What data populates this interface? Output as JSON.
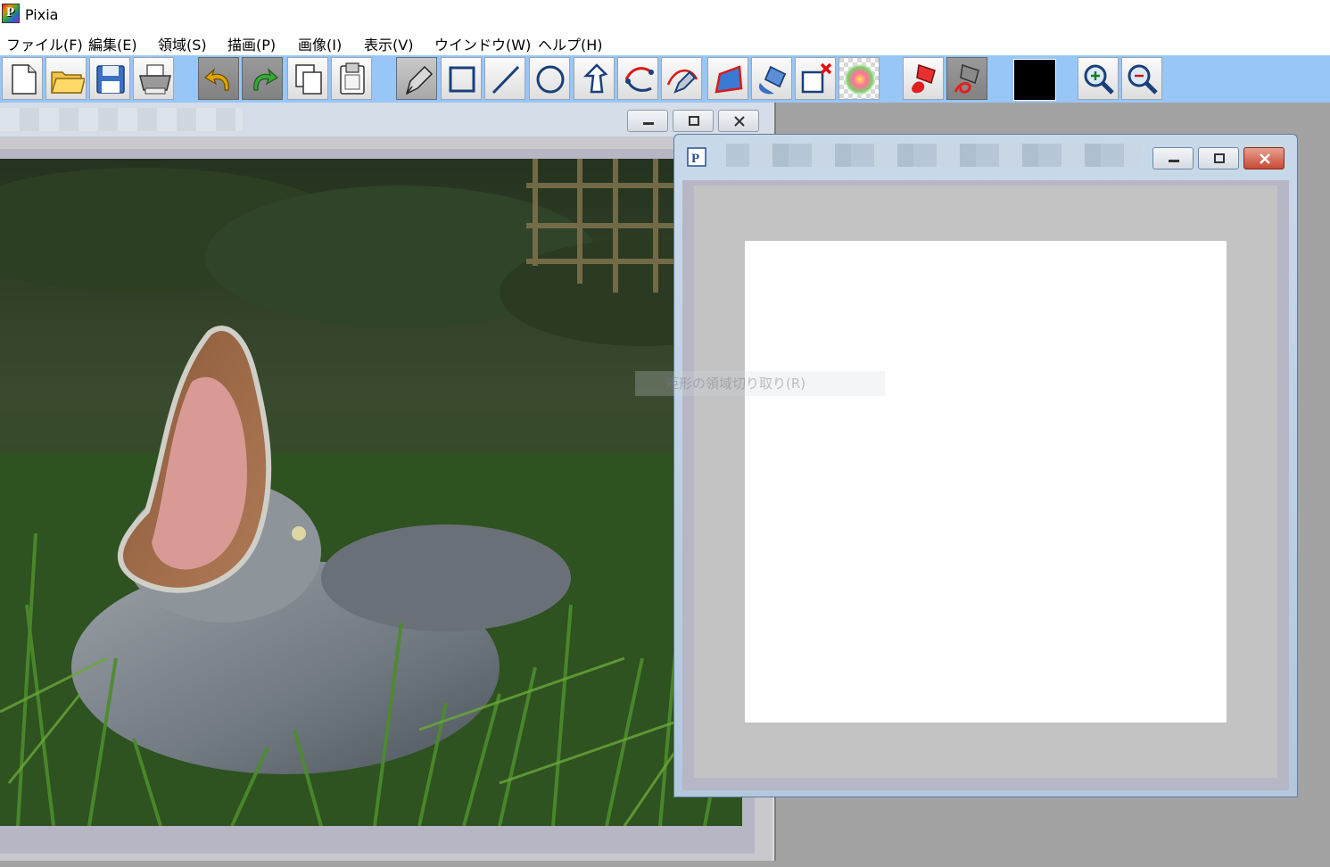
{
  "app": {
    "title": "Pixia",
    "icon": "pixia-app-icon"
  },
  "menu": [
    {
      "label": "ファイル(F)"
    },
    {
      "label": "編集(E)"
    },
    {
      "label": "領域(S)"
    },
    {
      "label": "描画(P)"
    },
    {
      "label": "画像(I)"
    },
    {
      "label": "表示(V)"
    },
    {
      "label": "ウインドウ(W)"
    },
    {
      "label": "ヘルプ(H)"
    }
  ],
  "toolbar": {
    "buttons": [
      {
        "icon": "new-file-icon"
      },
      {
        "icon": "open-folder-icon"
      },
      {
        "icon": "save-icon"
      },
      {
        "icon": "print-icon"
      },
      {
        "icon": "undo-icon"
      },
      {
        "icon": "redo-icon"
      },
      {
        "icon": "copy-icon"
      },
      {
        "icon": "paste-icon"
      },
      {
        "icon": "pen-tool-icon",
        "active": true
      },
      {
        "icon": "rectangle-tool-icon"
      },
      {
        "icon": "line-tool-icon"
      },
      {
        "icon": "ellipse-tool-icon"
      },
      {
        "icon": "freehand-select-icon"
      },
      {
        "icon": "curve-tool-icon"
      },
      {
        "icon": "bezier-pen-icon"
      },
      {
        "icon": "polygon-select-icon"
      },
      {
        "icon": "paint-bucket-icon"
      },
      {
        "icon": "clear-selection-icon"
      },
      {
        "icon": "gradient-icon"
      },
      {
        "icon": "red-bucket-icon"
      },
      {
        "icon": "red-eraser-bucket-icon"
      },
      {
        "icon": "zoom-in-icon"
      },
      {
        "icon": "zoom-out-icon"
      }
    ],
    "current_color": "#000000"
  },
  "ghost_menu_item": "矩形の領域切り取り(R)",
  "colors": {
    "toolbar_bg": "#98c6f7",
    "workspace_bg": "#a3a3a3",
    "canvas_bg": "#ffffff"
  }
}
